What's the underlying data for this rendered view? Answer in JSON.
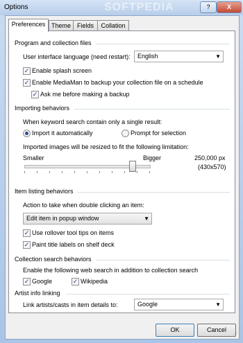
{
  "window": {
    "title": "Options",
    "watermark": "SOFTPEDIA",
    "help_label": "?",
    "close_label": "X"
  },
  "tabs": [
    "Preferences",
    "Theme",
    "Fields",
    "Collation"
  ],
  "program": {
    "heading": "Program and collection files",
    "language_label": "User interface language (need restart):",
    "language_value": "English",
    "splash_label": "Enable splash screen",
    "backup_label": "Enable MediaMan to backup your collection file on a schedule",
    "ask_label": "Ask me before making a backup"
  },
  "importing": {
    "heading": "Importing behaviors",
    "single_result_label": "When keyword search contain only a single result:",
    "import_auto_label": "Import it automatically",
    "prompt_label": "Prompt for selection",
    "resize_label": "Imported images will be resized to fit the following limitation:",
    "smaller_label": "Smaller",
    "bigger_label": "Bigger",
    "size_px": "250,000 px",
    "size_dims": "(430x570)",
    "slider_value_fraction": 0.86
  },
  "listing": {
    "heading": "Item listing behaviors",
    "double_click_label": "Action to take when double clicking an item:",
    "double_click_value": "Edit item in popup window",
    "rollover_label": "Use rollover tool tips on items",
    "paint_label": "Paint title labels on shelf deck"
  },
  "search": {
    "heading": "Collection search behaviors",
    "enable_label": "Enable the following web search in addition to collection search",
    "google_label": "Google",
    "wikipedia_label": "Wikipedia"
  },
  "artist": {
    "heading": "Artist info linking",
    "link_label": "Link artists/casts in item details to:",
    "link_value": "Google"
  },
  "buttons": {
    "ok": "OK",
    "cancel": "Cancel"
  },
  "glyphs": {
    "check": "✓",
    "down": "▼"
  }
}
